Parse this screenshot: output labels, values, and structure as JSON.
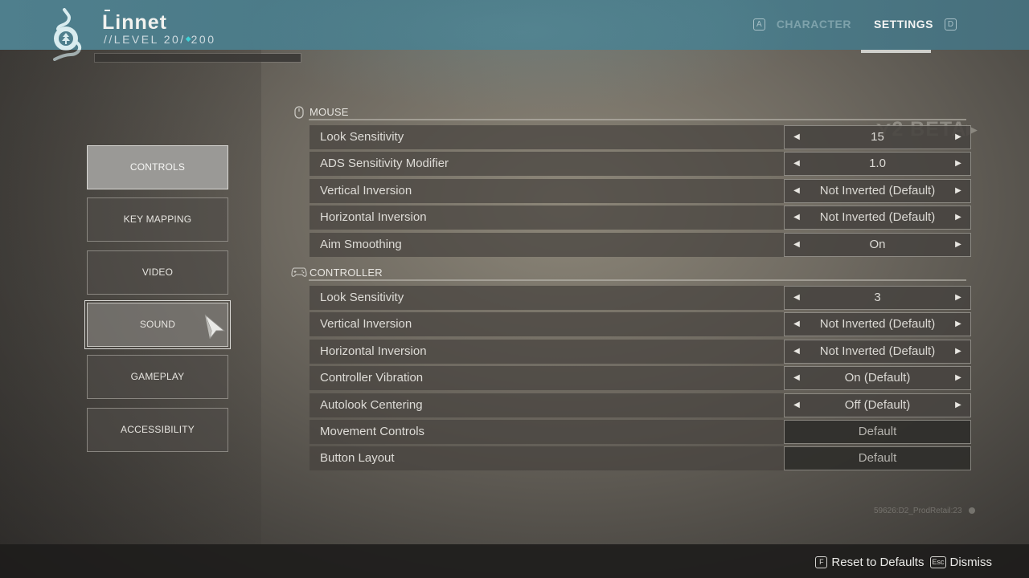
{
  "header": {
    "character_name": "Linnet",
    "level_prefix": "//LEVEL 20/",
    "power_icon": "diamond-icon",
    "power_level": "200",
    "xp_progress": 0.0,
    "tabs": [
      {
        "key": "A",
        "label": "CHARACTER",
        "active": false
      },
      {
        "label": "SETTINGS",
        "active": true,
        "key": "D"
      }
    ]
  },
  "sidebar": {
    "items": [
      {
        "label": "CONTROLS",
        "state": "selected"
      },
      {
        "label": "KEY MAPPING",
        "state": "normal"
      },
      {
        "label": "VIDEO",
        "state": "normal"
      },
      {
        "label": "SOUND",
        "state": "hover"
      },
      {
        "label": "GAMEPLAY",
        "state": "normal"
      },
      {
        "label": "ACCESSIBILITY",
        "state": "normal"
      }
    ]
  },
  "watermark": "2 BETA",
  "sections": {
    "mouse": {
      "icon": "mouse-icon",
      "title": "MOUSE",
      "rows": [
        {
          "label": "Look Sensitivity",
          "value": "15",
          "type": "selector"
        },
        {
          "label": "ADS Sensitivity Modifier",
          "value": "1.0",
          "type": "selector"
        },
        {
          "label": "Vertical Inversion",
          "value": "Not Inverted (Default)",
          "type": "selector"
        },
        {
          "label": "Horizontal Inversion",
          "value": "Not Inverted (Default)",
          "type": "selector"
        },
        {
          "label": "Aim Smoothing",
          "value": "On",
          "type": "selector"
        }
      ]
    },
    "controller": {
      "icon": "gamepad-icon",
      "title": "CONTROLLER",
      "rows": [
        {
          "label": "Look Sensitivity",
          "value": "3",
          "type": "selector"
        },
        {
          "label": "Vertical Inversion",
          "value": "Not Inverted (Default)",
          "type": "selector"
        },
        {
          "label": "Horizontal Inversion",
          "value": "Not Inverted (Default)",
          "type": "selector"
        },
        {
          "label": "Controller Vibration",
          "value": "On (Default)",
          "type": "selector"
        },
        {
          "label": "Autolook Centering",
          "value": "Off (Default)",
          "type": "selector"
        },
        {
          "label": "Movement Controls",
          "value": "Default",
          "type": "button"
        },
        {
          "label": "Button Layout",
          "value": "Default",
          "type": "button"
        }
      ]
    }
  },
  "arrows": {
    "left": "◀",
    "right": "▶"
  },
  "build_info": "59626:D2_ProdRetail:23",
  "footer": {
    "actions": [
      {
        "key": "F",
        "label": "Reset to Defaults"
      },
      {
        "key": "Esc",
        "label": "Dismiss"
      }
    ]
  }
}
